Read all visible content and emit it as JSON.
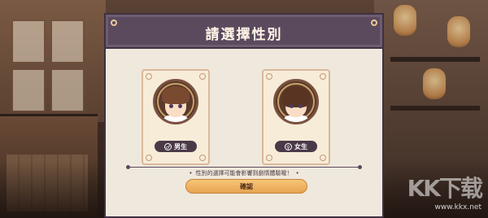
{
  "dialog": {
    "title": "請選擇性別",
    "options": [
      {
        "id": "male",
        "label": "男生",
        "symbol": "♂"
      },
      {
        "id": "female",
        "label": "女生",
        "symbol": "♀"
      }
    ],
    "hint": "性別的選擇可能會影響到劇情體驗喔！",
    "confirm_label": "確認"
  },
  "watermark": {
    "logo": "KK下载",
    "url": "www.kkx.net"
  },
  "colors": {
    "header": "#5b4a5e",
    "panel": "#efe8dc",
    "card": "#f7ecd8",
    "pill": "#4a3a48",
    "confirm": "#f1b865"
  }
}
